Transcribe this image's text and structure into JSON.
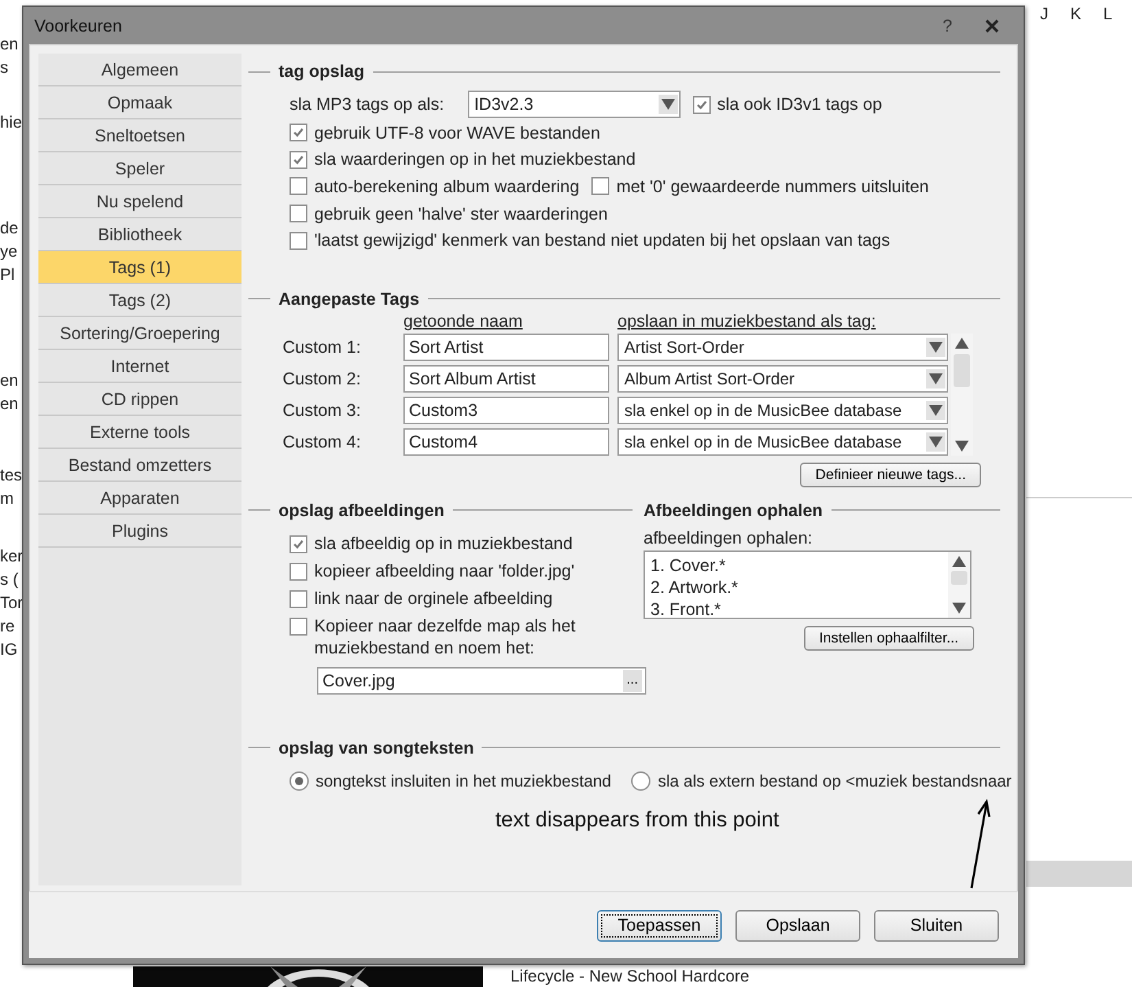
{
  "background": {
    "left_groups": [
      [
        "en",
        "s"
      ],
      [
        "hie"
      ],
      [
        "de",
        "ye",
        "Pl"
      ],
      [
        "en",
        "en"
      ],
      [
        "tes",
        "m"
      ],
      [
        "ker",
        "s (",
        "Tor",
        "re",
        "IG"
      ]
    ],
    "column_letters": [
      "J",
      "K",
      "L"
    ],
    "track_title": "Lifecycle - New School Hardcore"
  },
  "window": {
    "title": "Voorkeuren",
    "help": "?"
  },
  "sidebar": {
    "items": [
      {
        "label": "Algemeen",
        "selected": false
      },
      {
        "label": "Opmaak",
        "selected": false
      },
      {
        "label": "Sneltoetsen",
        "selected": false
      },
      {
        "label": "Speler",
        "selected": false
      },
      {
        "label": "Nu spelend",
        "selected": false
      },
      {
        "label": "Bibliotheek",
        "selected": false
      },
      {
        "label": "Tags (1)",
        "selected": true
      },
      {
        "label": "Tags (2)",
        "selected": false
      },
      {
        "label": "Sortering/Groepering",
        "selected": false
      },
      {
        "label": "Internet",
        "selected": false
      },
      {
        "label": "CD rippen",
        "selected": false
      },
      {
        "label": "Externe tools",
        "selected": false
      },
      {
        "label": "Bestand omzetters",
        "selected": false
      },
      {
        "label": "Apparaten",
        "selected": false
      },
      {
        "label": "Plugins",
        "selected": false
      }
    ]
  },
  "tag_storage": {
    "heading": "tag opslag",
    "mp3_label": "sla MP3 tags op als:",
    "mp3_value": "ID3v2.3",
    "id3v1": {
      "label": "sla ook ID3v1 tags op",
      "checked": true
    },
    "options": [
      {
        "label": "gebruik UTF-8 voor WAVE bestanden",
        "checked": true
      },
      {
        "label": "sla waarderingen op in het muziekbestand",
        "checked": true
      },
      {
        "label": "auto-berekening album waardering",
        "checked": false,
        "extra": {
          "label": "met '0' gewaardeerde nummers uitsluiten",
          "checked": false
        }
      },
      {
        "label": "gebruik geen 'halve' ster waarderingen",
        "checked": false
      },
      {
        "label": "'laatst gewijzigd' kenmerk van bestand niet updaten bij het opslaan van tags",
        "checked": false
      }
    ]
  },
  "custom_tags": {
    "heading": "Aangepaste Tags",
    "name_header": "getoonde naam",
    "tag_header": "opslaan in muziekbestand als tag:",
    "rows": [
      {
        "label": "Custom 1:",
        "name": "Sort Artist",
        "tag": "Artist Sort-Order"
      },
      {
        "label": "Custom 2:",
        "name": "Sort Album Artist",
        "tag": "Album Artist Sort-Order"
      },
      {
        "label": "Custom 3:",
        "name": "Custom3",
        "tag": "sla enkel op in de MusicBee database"
      },
      {
        "label": "Custom 4:",
        "name": "Custom4",
        "tag": "sla enkel op in de MusicBee database"
      }
    ],
    "button": "Definieer nieuwe tags..."
  },
  "artwork_storage": {
    "heading": "opslag afbeeldingen",
    "options": [
      {
        "label": "sla afbeeldig op in muziekbestand",
        "checked": true
      },
      {
        "label": "kopieer afbeelding naar 'folder.jpg'",
        "checked": false
      },
      {
        "label": "link naar de orginele afbeelding",
        "checked": false
      },
      {
        "label": "Kopieer naar dezelfde map als het muziekbestand en noem het:",
        "checked": false
      }
    ],
    "filename": "Cover.jpg",
    "browse": "..."
  },
  "artwork_fetch": {
    "heading": "Afbeeldingen ophalen",
    "label": "afbeeldingen ophalen:",
    "items": [
      "1. Cover.*",
      "2. Artwork.*",
      "3. Front.*"
    ],
    "button": "Instellen ophaalfilter..."
  },
  "lyrics": {
    "heading": "opslag van songteksten",
    "options": [
      {
        "label": "songtekst insluiten in het muziekbestand",
        "selected": true
      },
      {
        "label": "sla als extern bestand op <muziek bestandsnaar",
        "selected": false
      }
    ]
  },
  "annotation": "text disappears from this point",
  "buttons": [
    {
      "label": "Toepassen",
      "focused": true
    },
    {
      "label": "Opslaan",
      "focused": false
    },
    {
      "label": "Sluiten",
      "focused": false
    }
  ]
}
